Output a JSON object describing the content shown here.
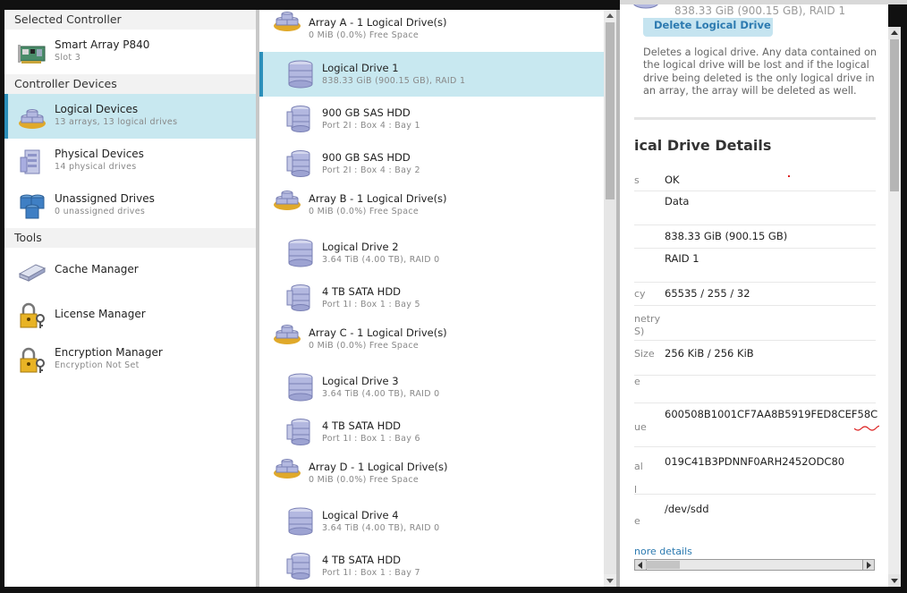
{
  "left": {
    "selected_controller_header": "Selected Controller",
    "controller": {
      "name": "Smart Array P840",
      "sub": "Slot 3"
    },
    "devices_header": "Controller Devices",
    "devices": [
      {
        "name": "Logical Devices",
        "sub": "13 arrays, 13 logical drives"
      },
      {
        "name": "Physical Devices",
        "sub": "14 physical drives"
      },
      {
        "name": "Unassigned Drives",
        "sub": "0 unassigned drives"
      }
    ],
    "tools_header": "Tools",
    "tools": [
      {
        "name": "Cache Manager",
        "sub": ""
      },
      {
        "name": "License Manager",
        "sub": ""
      },
      {
        "name": "Encryption Manager",
        "sub": "Encryption Not Set"
      }
    ]
  },
  "middle": {
    "rows": [
      {
        "kind": "array",
        "name": "Array A - 1 Logical Drive(s)",
        "sub": "0 MiB (0.0%) Free Space"
      },
      {
        "kind": "ld",
        "name": "Logical Drive 1",
        "sub": "838.33 GiB (900.15 GB), RAID 1"
      },
      {
        "kind": "pd",
        "name": "900 GB SAS HDD",
        "sub": "Port 2I : Box 4 : Bay 1"
      },
      {
        "kind": "pd",
        "name": "900 GB SAS HDD",
        "sub": "Port 2I : Box 4 : Bay 2"
      },
      {
        "kind": "array",
        "name": "Array B - 1 Logical Drive(s)",
        "sub": "0 MiB (0.0%) Free Space"
      },
      {
        "kind": "ld",
        "name": "Logical Drive 2",
        "sub": "3.64 TiB (4.00 TB), RAID 0"
      },
      {
        "kind": "pd",
        "name": "4 TB SATA HDD",
        "sub": "Port 1I : Box 1 : Bay 5"
      },
      {
        "kind": "array",
        "name": "Array C - 1 Logical Drive(s)",
        "sub": "0 MiB (0.0%) Free Space"
      },
      {
        "kind": "ld",
        "name": "Logical Drive 3",
        "sub": "3.64 TiB (4.00 TB), RAID 0"
      },
      {
        "kind": "pd",
        "name": "4 TB SATA HDD",
        "sub": "Port 1I : Box 1 : Bay 6"
      },
      {
        "kind": "array",
        "name": "Array D - 1 Logical Drive(s)",
        "sub": "0 MiB (0.0%) Free Space"
      },
      {
        "kind": "ld",
        "name": "Logical Drive 4",
        "sub": "3.64 TiB (4.00 TB), RAID 0"
      },
      {
        "kind": "pd",
        "name": "4 TB SATA HDD",
        "sub": "Port 1I : Box 1 : Bay 7"
      }
    ]
  },
  "right": {
    "top_value": "838.33 GiB (900.15 GB), RAID 1",
    "delete_button": "Delete Logical Drive",
    "delete_desc": "Deletes a logical drive. Any data contained on the logical drive will be lost and if the logical drive being deleted is the only logical drive in an array, the array will be deleted as well.",
    "details_title": "ical Drive Details",
    "props": [
      {
        "label": "s",
        "value": "OK"
      },
      {
        "label": "",
        "value": "Data"
      },
      {
        "label": "",
        "value": "838.33 GiB (900.15 GB)"
      },
      {
        "label": "",
        "value": "RAID 1"
      },
      {
        "label": "cy",
        "value": "65535 / 255 / 32"
      },
      {
        "label": "netry\nS)",
        "value": ""
      },
      {
        "label": "Size",
        "value": "256 KiB / 256 KiB"
      },
      {
        "label": "e",
        "value": ""
      },
      {
        "label": "ue",
        "value": "600508B1001CF7AA8B5919FED8CEF58C"
      },
      {
        "label": "al\nl",
        "value": "019C41B3PDNNF0ARH2452ODC80"
      },
      {
        "label": "e",
        "value": "/dev/sdd"
      }
    ],
    "more_details": "nore details"
  }
}
